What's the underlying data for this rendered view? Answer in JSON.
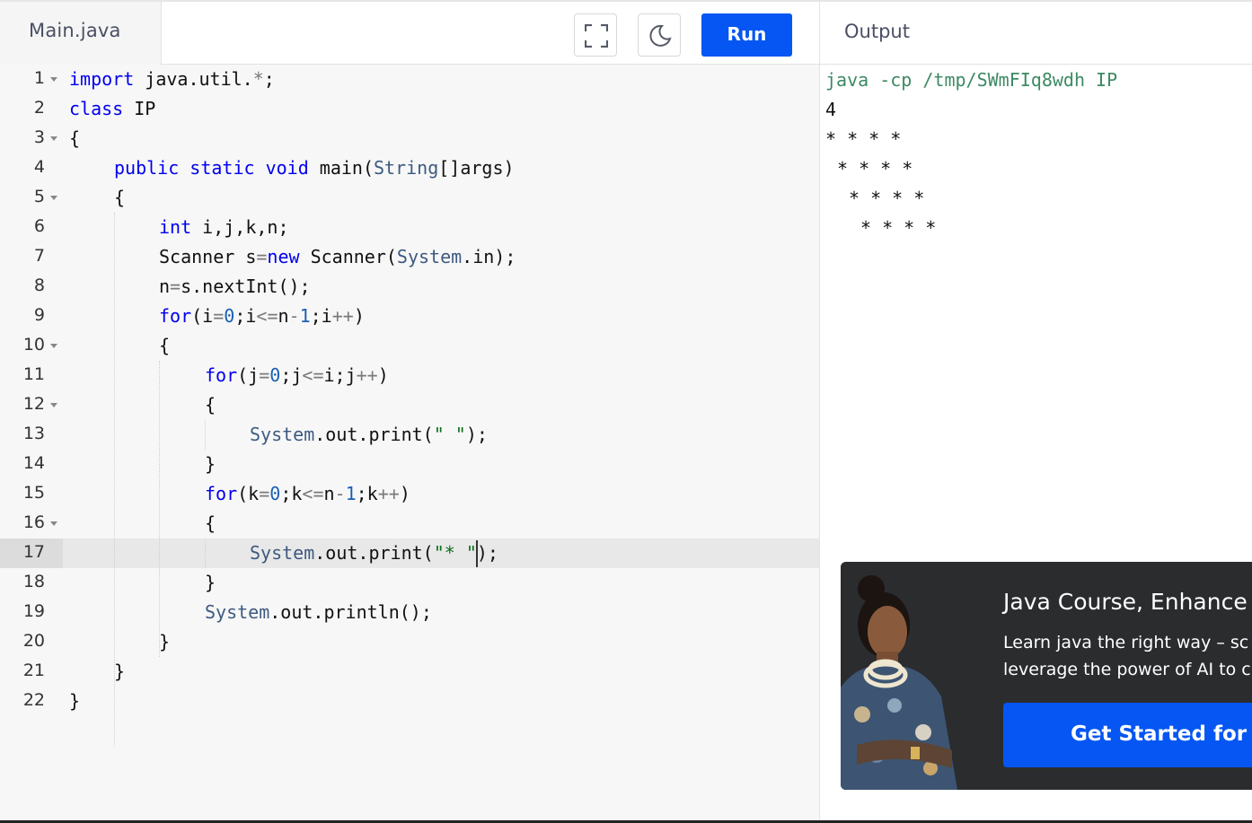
{
  "editor": {
    "file_tab": "Main.java",
    "run_label": "Run",
    "icons": [
      "fullscreen-icon",
      "moon-icon"
    ]
  },
  "code_lines": [
    {
      "num": "1",
      "fold": true
    },
    {
      "num": "2",
      "fold": false
    },
    {
      "num": "3",
      "fold": true
    },
    {
      "num": "4",
      "fold": false
    },
    {
      "num": "5",
      "fold": true
    },
    {
      "num": "6",
      "fold": false
    },
    {
      "num": "7",
      "fold": false
    },
    {
      "num": "8",
      "fold": false
    },
    {
      "num": "9",
      "fold": false
    },
    {
      "num": "10",
      "fold": true
    },
    {
      "num": "11",
      "fold": false
    },
    {
      "num": "12",
      "fold": true
    },
    {
      "num": "13",
      "fold": false
    },
    {
      "num": "14",
      "fold": false
    },
    {
      "num": "15",
      "fold": false
    },
    {
      "num": "16",
      "fold": true
    },
    {
      "num": "17",
      "fold": false
    },
    {
      "num": "18",
      "fold": false
    },
    {
      "num": "19",
      "fold": false
    },
    {
      "num": "20",
      "fold": false
    },
    {
      "num": "21",
      "fold": false
    },
    {
      "num": "22",
      "fold": false
    }
  ],
  "code": {
    "l1": {
      "kw": "import",
      "rest": " java.util.",
      "op": "*",
      "end": ";"
    },
    "l2": {
      "kw": "class",
      "rest": " IP"
    },
    "l3": "{",
    "l4": {
      "kw1": "public",
      "kw2": "static",
      "kw3": "void",
      "a": " main(",
      "tp": "String",
      "b": "[]args)"
    },
    "l5": "{",
    "l6": {
      "kw": "int",
      "rest": " i,j,k,n;"
    },
    "l7": {
      "a": "Scanner s",
      "op": "=",
      "kw": "new",
      "b": " Scanner(",
      "tp": "System",
      "c": ".in);"
    },
    "l8": {
      "a": "n",
      "op": "=",
      "b": "s.nextInt();"
    },
    "l9": {
      "kw": "for",
      "a": "(i",
      "op1": "=",
      "n1": "0",
      "b": ";i",
      "op2": "<=",
      "c": "n",
      "op3": "-",
      "n2": "1",
      "d": ";i",
      "op4": "++",
      "e": ")"
    },
    "l10": "{",
    "l11": {
      "kw": "for",
      "a": "(j",
      "op1": "=",
      "n1": "0",
      "b": ";j",
      "op2": "<=",
      "c": "i;j",
      "op3": "++",
      "d": ")"
    },
    "l12": "{",
    "l13": {
      "tp": "System",
      "a": ".out.print(",
      "str": "\" \"",
      "b": ");"
    },
    "l14": "}",
    "l15": {
      "kw": "for",
      "a": "(k",
      "op1": "=",
      "n1": "0",
      "b": ";k",
      "op2": "<=",
      "c": "n",
      "op3": "-",
      "n2": "1",
      "d": ";k",
      "op4": "++",
      "e": ")"
    },
    "l16": "{",
    "l17": {
      "tp": "System",
      "a": ".out.print(",
      "str": "\"* \"",
      "b": ");"
    },
    "l18": "}",
    "l19": {
      "tp": "System",
      "a": ".out.println();"
    },
    "l20": "}",
    "l21": "}",
    "l22": "}"
  },
  "output": {
    "title": "Output",
    "command": "java -cp /tmp/SWmFIq8wdh IP",
    "lines": [
      "4",
      "* * * *",
      "  * * * *",
      "   * * * *",
      "    * * * *"
    ]
  },
  "ad": {
    "title": "Java Course, Enhance",
    "desc_line1": "Learn java the right way – sc",
    "desc_line2": "leverage the power of AI to c",
    "button": "Get Started for Fre"
  }
}
